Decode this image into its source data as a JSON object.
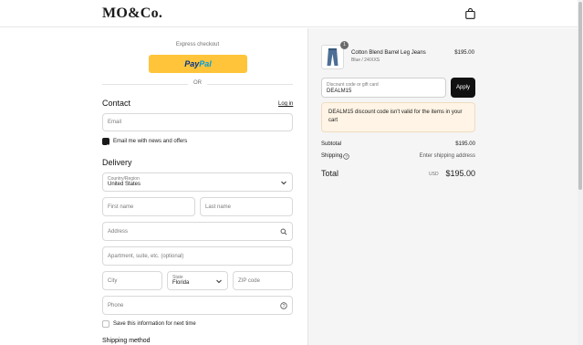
{
  "header": {
    "logo": "MO&Co.",
    "bag_icon": "shopping-bag-icon"
  },
  "express": {
    "label": "Express checkout",
    "paypal_label_1": "Pay",
    "paypal_label_2": "Pal",
    "or": "OR"
  },
  "contact": {
    "heading": "Contact",
    "login_link": "Log in",
    "email_placeholder": "Email",
    "newsletter_label": "Email me with news and offers",
    "newsletter_checked": true
  },
  "delivery": {
    "heading": "Delivery",
    "country_label": "Country/Region",
    "country_value": "United States",
    "first_name_placeholder": "First name",
    "last_name_placeholder": "Last name",
    "address_placeholder": "Address",
    "apartment_placeholder": "Apartment, suite, etc. (optional)",
    "city_placeholder": "City",
    "state_label": "State",
    "state_value": "Florida",
    "zip_placeholder": "ZIP code",
    "phone_placeholder": "Phone",
    "save_info_label": "Save this information for next time",
    "save_info_checked": false
  },
  "shipping_method": {
    "heading": "Shipping method"
  },
  "order": {
    "item": {
      "quantity": "1",
      "name": "Cotton Blend Barrel Leg Jeans",
      "variant": "Blue / 24/XXS",
      "price": "$195.00"
    },
    "discount_label": "Discount code or gift card",
    "discount_value": "DEALM15",
    "apply_label": "Apply",
    "error_message": "DEALM15 discount code isn't valid for the items in your cart",
    "subtotal_label": "Subtotal",
    "subtotal_value": "$195.00",
    "shipping_label": "Shipping",
    "shipping_value": "Enter shipping address",
    "total_label": "Total",
    "currency": "USD",
    "total_value": "$195.00"
  },
  "colors": {
    "paypal": "#ffc439",
    "apply_button": "#111111",
    "alert_bg": "#fff4e5",
    "summary_bg": "#f5f5f5"
  }
}
